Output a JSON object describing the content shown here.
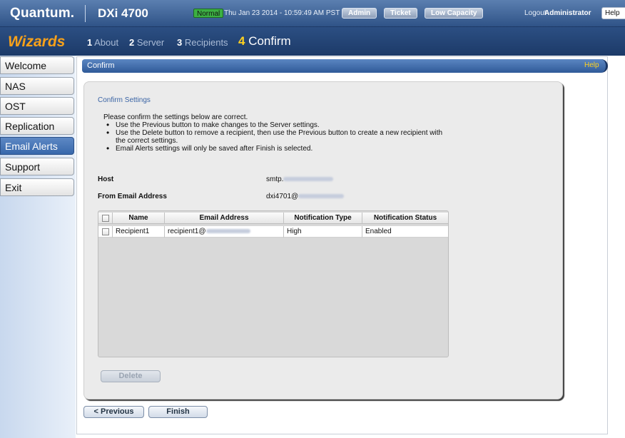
{
  "topbar": {
    "brand": "Quantum.",
    "product": "DXi 4700",
    "status": "Normal",
    "datetime": "Thu Jan 23 2014 - 10:59:49 AM PST",
    "buttons": [
      "Admin",
      "Ticket",
      "Low Capacity"
    ],
    "logout": "Logout",
    "user": "Administrator",
    "help": "Help"
  },
  "wizard": {
    "title": "Wizards",
    "steps": [
      {
        "num": "1",
        "label": "About"
      },
      {
        "num": "2",
        "label": "Server"
      },
      {
        "num": "3",
        "label": "Recipients"
      },
      {
        "num": "4",
        "label": "Confirm"
      }
    ],
    "active_step": 4
  },
  "sidebar": {
    "items": [
      {
        "label": "Welcome"
      },
      {
        "label": "NAS"
      },
      {
        "label": "OST"
      },
      {
        "label": "Replication"
      },
      {
        "label": "Email Alerts"
      },
      {
        "label": "Support"
      },
      {
        "label": "Exit"
      }
    ],
    "active": "Email Alerts"
  },
  "section": {
    "title": "Confirm",
    "help": "Help"
  },
  "confirm": {
    "title": "Confirm Settings",
    "intro": "Please confirm the settings below are correct.",
    "bullets": [
      "Use the Previous button to make changes to the Server settings.",
      "Use the Delete button to remove a recipient, then use the Previous button to create a new recipient with the correct settings.",
      "Email Alerts settings will only be saved after Finish is selected."
    ],
    "host_label": "Host",
    "host_value": "smtp.",
    "from_label": "From Email Address",
    "from_value": "dxi4701@"
  },
  "table": {
    "columns": [
      "Name",
      "Email Address",
      "Notification Type",
      "Notification Status"
    ],
    "rows": [
      {
        "name": "Recipient1",
        "email": "recipient1@",
        "type": "High",
        "status": "Enabled"
      }
    ]
  },
  "buttons": {
    "delete": "Delete",
    "previous": "< Previous",
    "finish": "Finish"
  },
  "colors": {
    "header_blue": "#2f5387",
    "wizard_orange": "#f7a11a",
    "active_step_yellow": "#ffd21f",
    "status_green": "#3cb043"
  }
}
